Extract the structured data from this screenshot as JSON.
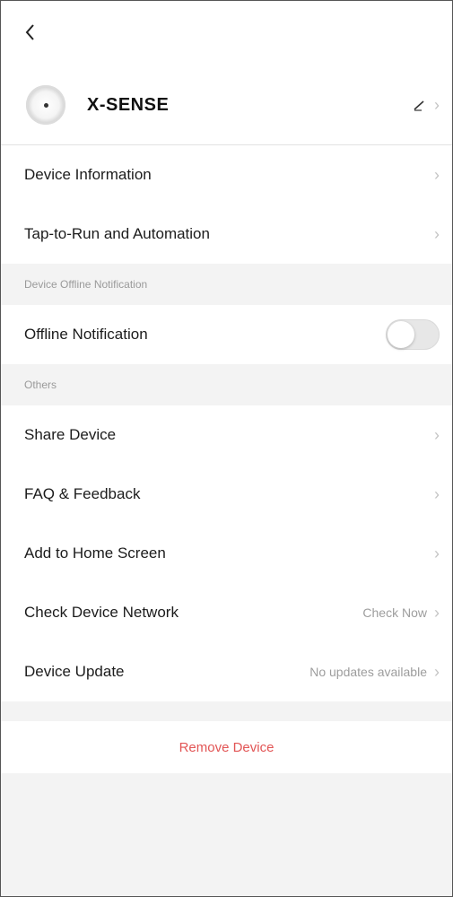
{
  "device": {
    "name": "X-SENSE"
  },
  "rows_top": [
    {
      "label": "Device Information"
    },
    {
      "label": "Tap-to-Run and Automation"
    }
  ],
  "sections": {
    "offline_label": "Device Offline Notification",
    "others_label": "Others"
  },
  "offline": {
    "label": "Offline Notification",
    "enabled": false
  },
  "rows_others": [
    {
      "label": "Share Device",
      "value": ""
    },
    {
      "label": "FAQ & Feedback",
      "value": ""
    },
    {
      "label": "Add to Home Screen",
      "value": ""
    },
    {
      "label": "Check Device Network",
      "value": "Check Now"
    },
    {
      "label": "Device Update",
      "value": "No updates available"
    }
  ],
  "remove_label": "Remove Device",
  "colors": {
    "danger": "#e25555",
    "muted": "#9a9a9a"
  }
}
